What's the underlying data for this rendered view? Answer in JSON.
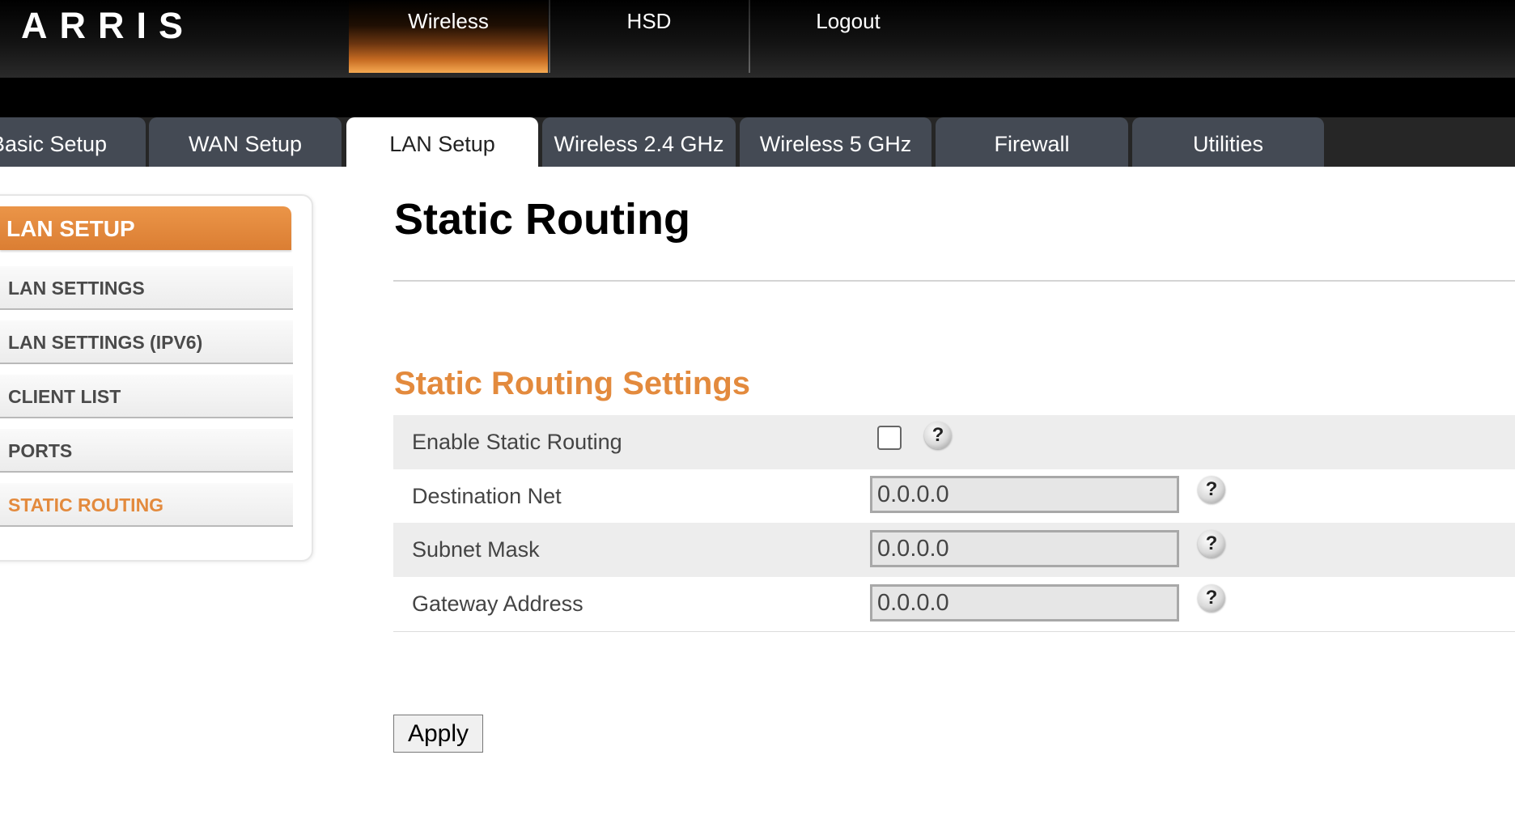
{
  "brand": {
    "logo_text": "ARRIS"
  },
  "top_nav": {
    "items": [
      {
        "label": "Wireless",
        "active": true
      },
      {
        "label": "HSD",
        "active": false
      },
      {
        "label": "Logout",
        "active": false
      }
    ],
    "active_gradient_color": "#f6aa52"
  },
  "tabs": {
    "items": [
      {
        "label": "Basic Setup"
      },
      {
        "label": "WAN Setup"
      },
      {
        "label": "LAN Setup"
      },
      {
        "label": "Wireless 2.4 GHz"
      },
      {
        "label": "Wireless 5 GHz"
      },
      {
        "label": "Firewall"
      },
      {
        "label": "Utilities"
      }
    ],
    "active": "LAN Setup"
  },
  "sidebar": {
    "header": "LAN SETUP",
    "items": [
      {
        "label": "LAN SETTINGS"
      },
      {
        "label": "LAN SETTINGS (IPV6)"
      },
      {
        "label": "CLIENT LIST"
      },
      {
        "label": "PORTS"
      },
      {
        "label": "STATIC ROUTING"
      }
    ],
    "active": "STATIC ROUTING"
  },
  "main": {
    "title": "Static Routing",
    "section_title": "Static Routing Settings",
    "form": {
      "enable_label": "Enable Static Routing",
      "enable_checked": false,
      "destination_label": "Destination Net",
      "destination_value": "0.0.0.0",
      "subnet_label": "Subnet Mask",
      "subnet_value": "0.0.0.0",
      "gateway_label": "Gateway Address",
      "gateway_value": "0.0.0.0",
      "help_symbol": "?"
    },
    "apply_label": "Apply"
  },
  "colors": {
    "accent_orange": "#e38a3d",
    "top_bar": "#000000",
    "tab_background": "#444a54",
    "row_shade": "#ededed"
  },
  "icons": {
    "help": "help-icon"
  }
}
